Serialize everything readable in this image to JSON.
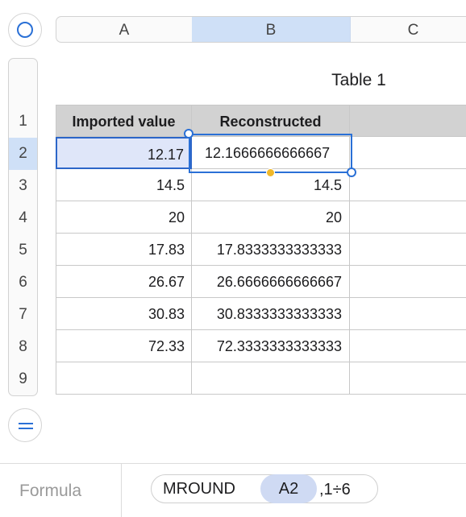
{
  "sheet": {
    "columns": [
      "A",
      "B",
      "C"
    ],
    "rows": [
      "1",
      "2",
      "3",
      "4",
      "5",
      "6",
      "7",
      "8",
      "9"
    ],
    "table_title": "Table 1",
    "headers": [
      "Imported value",
      "Reconstructed"
    ],
    "data": [
      [
        "12.17",
        "12.1666666666667"
      ],
      [
        "14.5",
        "14.5"
      ],
      [
        "20",
        "20"
      ],
      [
        "17.83",
        "17.8333333333333"
      ],
      [
        "26.67",
        "26.6666666666667"
      ],
      [
        "30.83",
        "30.8333333333333"
      ],
      [
        "72.33",
        "72.3333333333333"
      ],
      [
        "",
        ""
      ]
    ],
    "selected_cell": "A2",
    "editing_cell": "B2"
  },
  "formula_bar": {
    "label": "Formula",
    "function": "MROUND",
    "reference": "A2",
    "arguments": ",1÷6"
  },
  "colors": {
    "accent": "#2a70d6",
    "selection_fill": "#cfe0f7",
    "header_row": "#d2d2d2",
    "handle_yellow": "#f0b829"
  }
}
